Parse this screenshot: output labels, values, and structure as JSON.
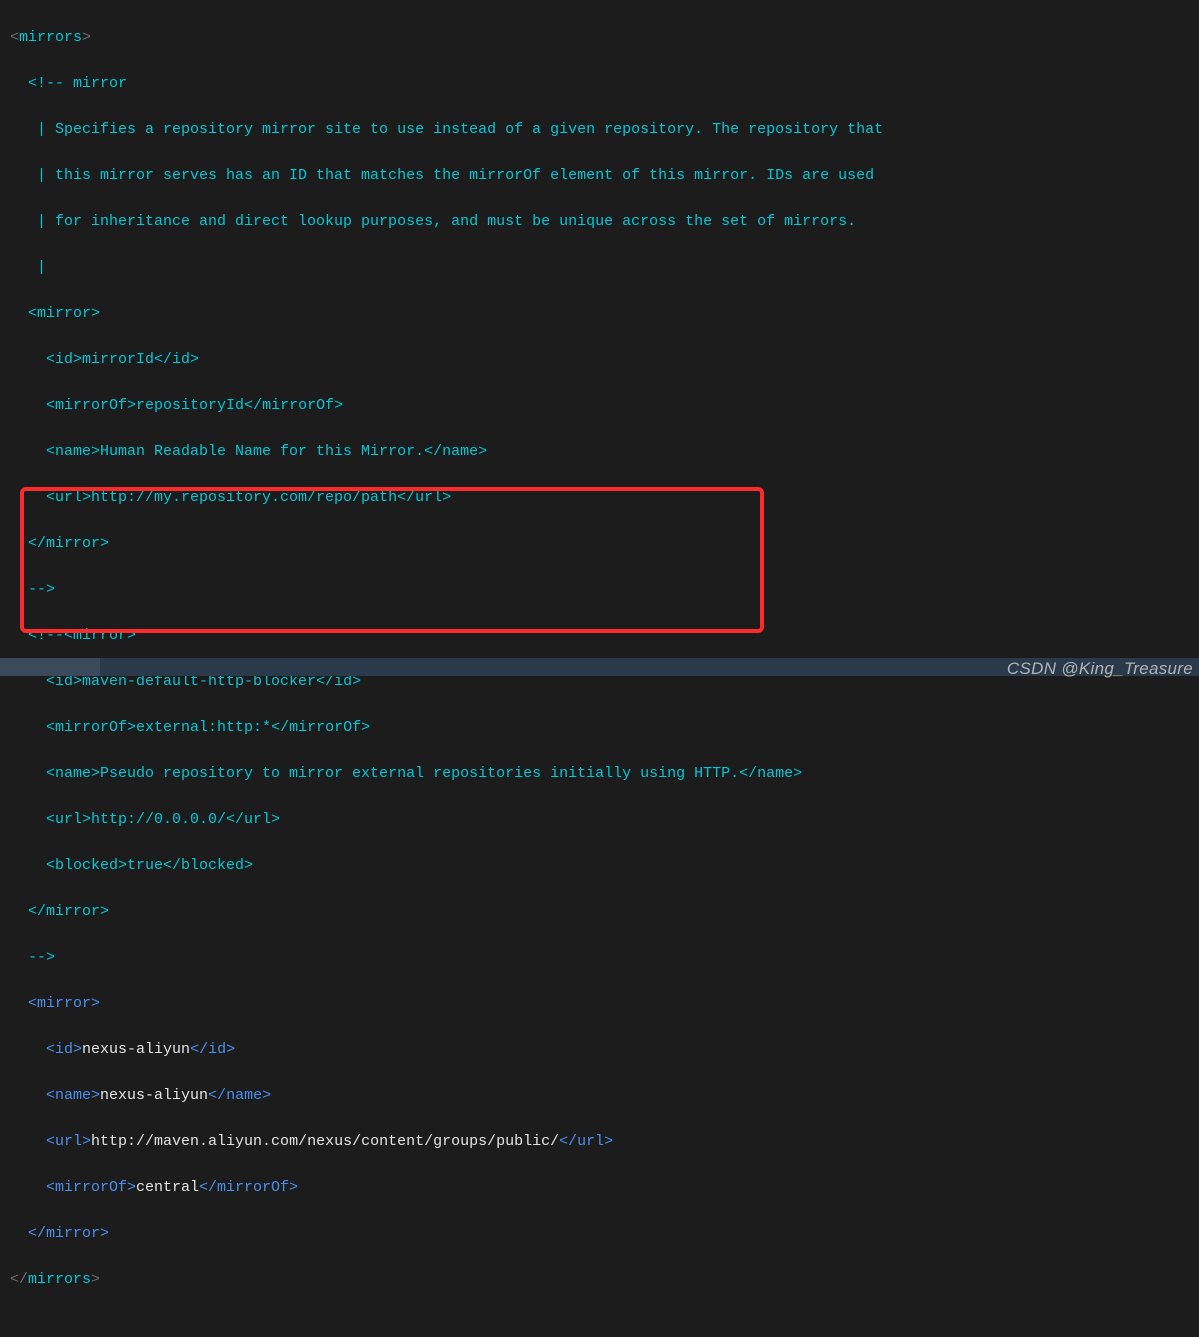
{
  "code": {
    "l1": {
      "p1": "<",
      "t": "mirrors",
      "p2": ">"
    },
    "comment_open": "  <!-- mirror",
    "c1": "   | Specifies a repository mirror site to use instead of a given repository. The repository that",
    "c2": "   | this mirror serves has an ID that matches the mirrorOf element of this mirror. IDs are used",
    "c3": "   | for inheritance and direct lookup purposes, and must be unique across the set of mirrors.",
    "c4": "   |",
    "m1_open": "  <mirror>",
    "m1_id_o": "    <id>",
    "m1_id": "mirrorId",
    "m1_id_c": "</id>",
    "m1_of_o": "    <mirrorOf>",
    "m1_of": "repositoryId",
    "m1_of_c": "</mirrorOf>",
    "m1_nm_o": "    <name>",
    "m1_nm": "Human Readable Name for this Mirror.",
    "m1_nm_c": "</name>",
    "m1_url_o": "    <url>",
    "m1_url": "http://my.repository.com/repo/path",
    "m1_url_c": "</url>",
    "m1_close": "  </mirror>",
    "comment_close": "  -->",
    "c2_open": "  <!--",
    "c2_open_t": "<mirror>",
    "m2_id_o": "    <id>",
    "m2_id": "maven-default-http-blocker",
    "m2_id_c": "</id>",
    "m2_of_o": "    <mirrorOf>",
    "m2_of": "external:http:*",
    "m2_of_c": "</mirrorOf>",
    "m2_nm_o": "    <name>",
    "m2_nm": "Pseudo repository to mirror external repositories initially using HTTP.",
    "m2_nm_c": "</name>",
    "m2_url_o": "    <url>",
    "m2_url": "http://0.0.0.0/",
    "m2_url_c": "</url>",
    "m2_bl_o": "    <blocked>",
    "m2_bl": "true",
    "m2_bl_c": "</blocked>",
    "m2_close": "  </mirror>",
    "c2_close": "  -->",
    "m3_open_i": "  ",
    "m3_open": "<mirror>",
    "m3_id_i": "    ",
    "m3_id_o": "<id>",
    "m3_id": "nexus-aliyun",
    "m3_id_c": "</id>",
    "m3_nm_i": "    ",
    "m3_nm_o": "<name>",
    "m3_nm": "nexus-aliyun",
    "m3_nm_c": "</name>",
    "m3_url_i": "    ",
    "m3_url_o": "<url>",
    "m3_url": "http://maven.aliyun.com/nexus/content/groups/public/",
    "m3_url_c": "</url>",
    "m3_of_i": "    ",
    "m3_of_o": "<mirrorOf>",
    "m3_of": "central",
    "m3_of_c": "</mirrorOf>",
    "m3_close_i": "  ",
    "m3_close": "</mirror>",
    "mirrors_close": {
      "p1": "</",
      "t": "mirrors",
      "p2": ">"
    }
  },
  "watermark": "CSDN @King_Treasure"
}
